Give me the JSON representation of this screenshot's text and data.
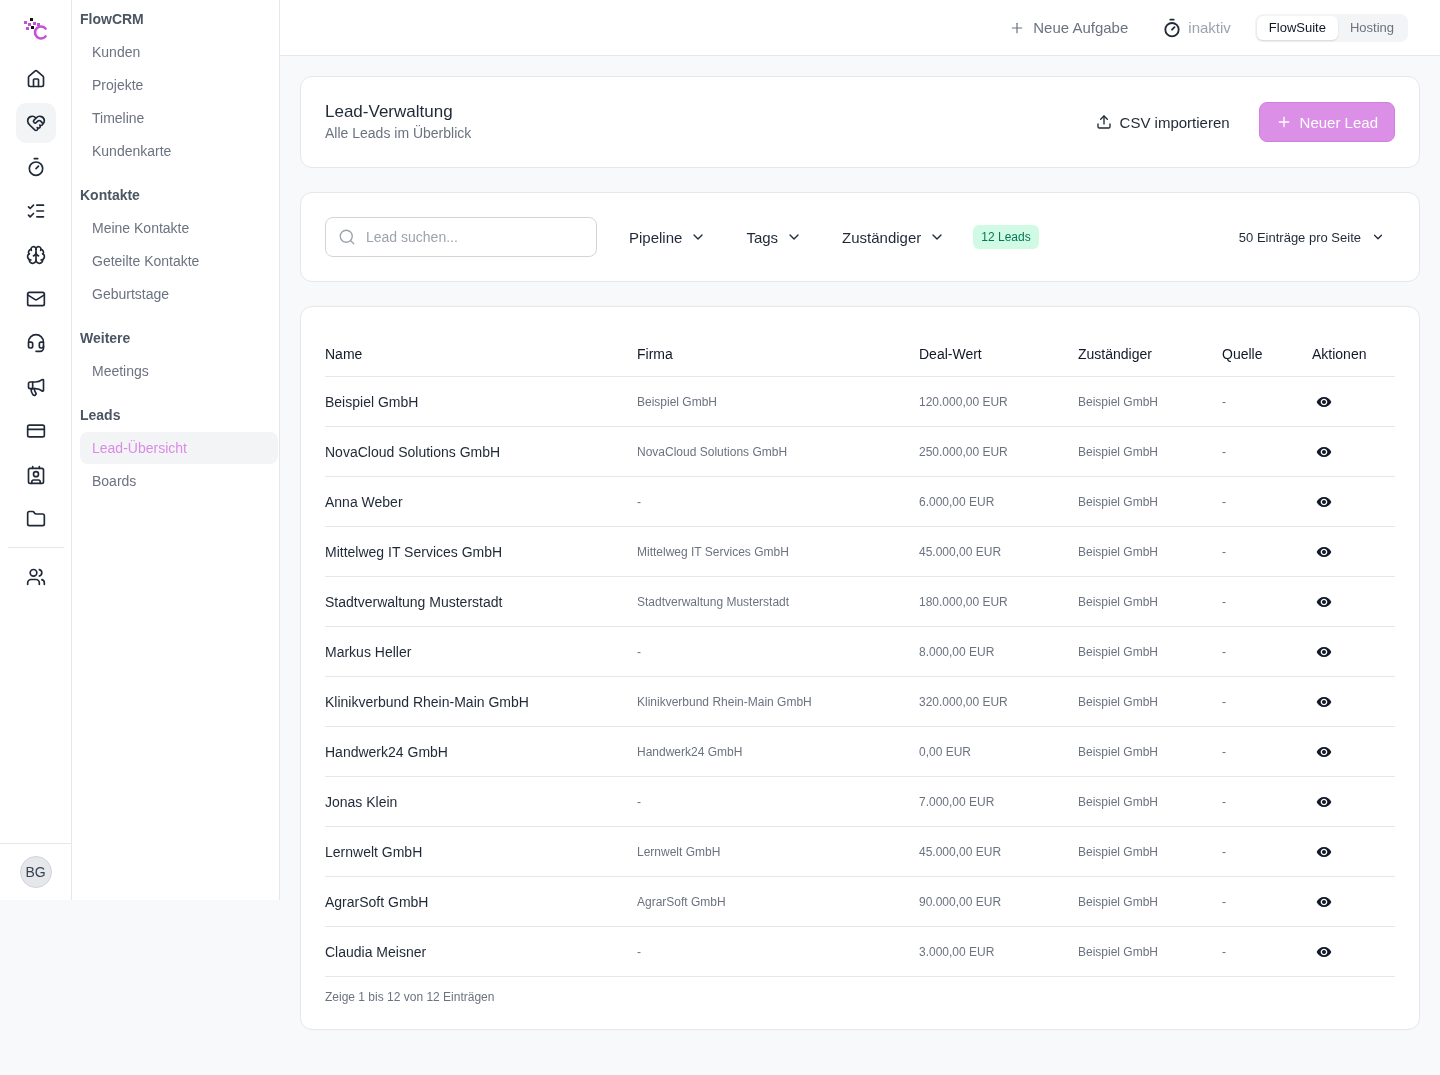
{
  "app_rail": {
    "items": [
      {
        "selected": false
      },
      {
        "selected": true
      },
      {
        "selected": false
      },
      {
        "selected": false
      },
      {
        "selected": false
      },
      {
        "selected": false
      },
      {
        "selected": false
      },
      {
        "selected": false
      },
      {
        "selected": false
      },
      {
        "selected": false
      },
      {
        "selected": false
      }
    ],
    "extra_items": [
      {
        "selected": false
      }
    ],
    "avatar": "BG"
  },
  "sidebar": {
    "sections": [
      {
        "title": "FlowCRM",
        "items": [
          {
            "label": "Kunden",
            "selected": false
          },
          {
            "label": "Projekte",
            "selected": false
          },
          {
            "label": "Timeline",
            "selected": false
          },
          {
            "label": "Kundenkarte",
            "selected": false
          }
        ]
      },
      {
        "title": "Kontakte",
        "items": [
          {
            "label": "Meine Kontakte",
            "selected": false
          },
          {
            "label": "Geteilte Kontakte",
            "selected": false
          },
          {
            "label": "Geburtstage",
            "selected": false
          }
        ]
      },
      {
        "title": "Weitere",
        "items": [
          {
            "label": "Meetings",
            "selected": false
          }
        ]
      },
      {
        "title": "Leads",
        "items": [
          {
            "label": "Lead-Übersicht",
            "selected": true
          },
          {
            "label": "Boards",
            "selected": false
          }
        ]
      }
    ]
  },
  "header": {
    "new_task": "Neue Aufgabe",
    "timer_status": "inaktiv",
    "workspace_tabs": [
      {
        "label": "FlowSuite",
        "selected": true
      },
      {
        "label": "Hosting",
        "selected": false
      }
    ]
  },
  "page_header": {
    "title": "Lead-Verwaltung",
    "subtitle": "Alle Leads im Überblick",
    "buttons": [
      {
        "kind": "secondary",
        "label": "CSV importieren"
      },
      {
        "kind": "primary",
        "label": "Neuer Lead"
      }
    ]
  },
  "filters": {
    "search": {
      "placeholder": "Lead suchen..."
    },
    "dropdowns": [
      "Pipeline",
      "Tags",
      "Zuständiger"
    ],
    "count_badge": "12 Leads",
    "page_size": "50 Einträge pro Seite"
  },
  "table": {
    "columns": [
      "Name",
      "Firma",
      "Deal-Wert",
      "Zuständiger",
      "Quelle",
      "Aktionen"
    ],
    "rows": [
      {
        "name": "Beispiel GmbH",
        "company": "Beispiel GmbH",
        "deal_value": "120.000,00 EUR",
        "owner": "Beispiel GmbH",
        "source": "-"
      },
      {
        "name": "NovaCloud Solutions GmbH",
        "company": "NovaCloud Solutions GmbH",
        "deal_value": "250.000,00 EUR",
        "owner": "Beispiel GmbH",
        "source": "-"
      },
      {
        "name": "Anna Weber",
        "company": "-",
        "deal_value": "6.000,00 EUR",
        "owner": "Beispiel GmbH",
        "source": "-"
      },
      {
        "name": "Mittelweg IT Services GmbH",
        "company": "Mittelweg IT Services GmbH",
        "deal_value": "45.000,00 EUR",
        "owner": "Beispiel GmbH",
        "source": "-"
      },
      {
        "name": "Stadtverwaltung Musterstadt",
        "company": "Stadtverwaltung Musterstadt",
        "deal_value": "180.000,00 EUR",
        "owner": "Beispiel GmbH",
        "source": "-"
      },
      {
        "name": "Markus Heller",
        "company": "-",
        "deal_value": "8.000,00 EUR",
        "owner": "Beispiel GmbH",
        "source": "-"
      },
      {
        "name": "Klinikverbund Rhein-Main GmbH",
        "company": "Klinikverbund Rhein-Main GmbH",
        "deal_value": "320.000,00 EUR",
        "owner": "Beispiel GmbH",
        "source": "-"
      },
      {
        "name": "Handwerk24 GmbH",
        "company": "Handwerk24 GmbH",
        "deal_value": "0,00 EUR",
        "owner": "Beispiel GmbH",
        "source": "-"
      },
      {
        "name": "Jonas Klein",
        "company": "-",
        "deal_value": "7.000,00 EUR",
        "owner": "Beispiel GmbH",
        "source": "-"
      },
      {
        "name": "Lernwelt GmbH",
        "company": "Lernwelt GmbH",
        "deal_value": "45.000,00 EUR",
        "owner": "Beispiel GmbH",
        "source": "-"
      },
      {
        "name": "AgrarSoft GmbH",
        "company": "AgrarSoft GmbH",
        "deal_value": "90.000,00 EUR",
        "owner": "Beispiel GmbH",
        "source": "-"
      },
      {
        "name": "Claudia Meisner",
        "company": "-",
        "deal_value": "3.000,00 EUR",
        "owner": "Beispiel GmbH",
        "source": "-"
      }
    ],
    "footer": "Zeige 1 bis 12 von 12 Einträgen"
  }
}
